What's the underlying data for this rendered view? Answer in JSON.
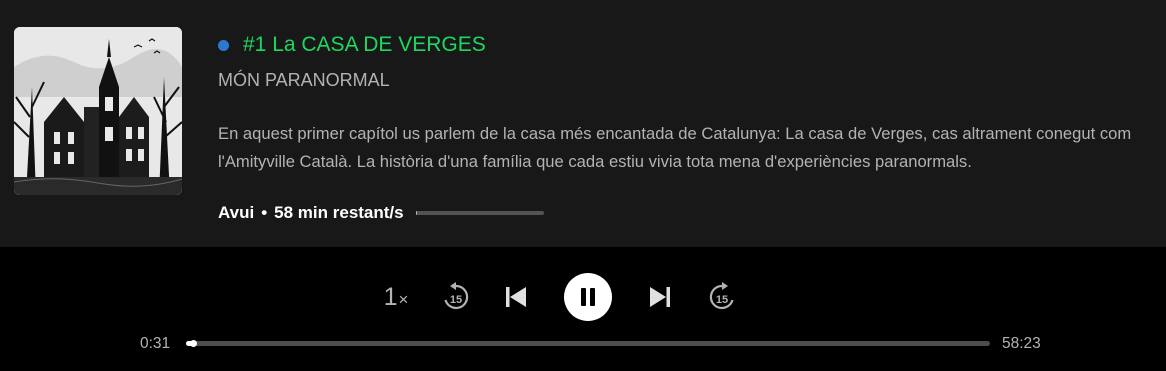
{
  "episode": {
    "title": "#1 La CASA DE VERGES",
    "show": "MÓN PARANORMAL",
    "description": "En aquest primer capítol us parlem de la casa més encantada de Catalunya: La casa de Verges, cas altrament conegut com l'Amityville Català. La història d'una família que cada estiu vivia tota mena d'experiències paranormals.",
    "date": "Avui",
    "separator": "•",
    "remaining": "58 min restant/s",
    "played_fraction": 0.01,
    "cover_icon": "haunted-house-artwork"
  },
  "player": {
    "speed_value": "1",
    "speed_suffix": "×",
    "skip_back_seconds": "15",
    "skip_forward_seconds": "15",
    "elapsed": "0:31",
    "total": "58:23",
    "progress_fraction": 0.009,
    "state": "playing"
  },
  "colors": {
    "accent": "#1ed760",
    "new_dot": "#2e77d0",
    "card_bg": "#181818",
    "bar_bg": "#000000"
  }
}
